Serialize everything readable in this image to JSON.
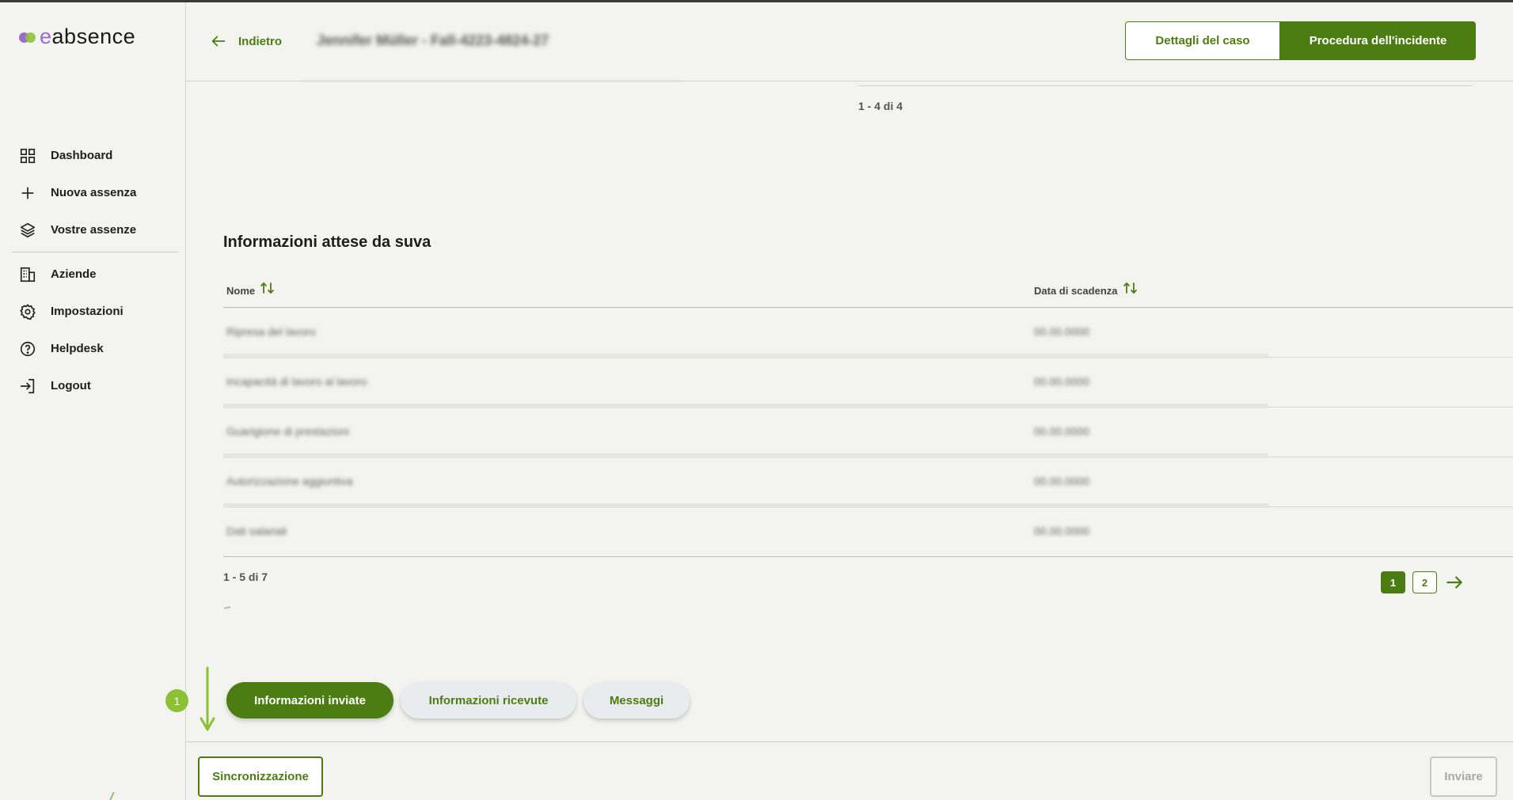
{
  "app": {
    "logo_prefix": "e",
    "logo_rest": "absence",
    "logo_icon": "logo-circles-icon"
  },
  "sidebar": {
    "items": [
      {
        "label": "Dashboard",
        "icon": "grid-icon"
      },
      {
        "label": "Nuova assenza",
        "icon": "plus-icon"
      },
      {
        "label": "Vostre assenze",
        "icon": "layers-icon"
      },
      {
        "label": "Aziende",
        "icon": "building-icon"
      },
      {
        "label": "Impostazioni",
        "icon": "gear-icon"
      },
      {
        "label": "Helpdesk",
        "icon": "help-circle-icon"
      },
      {
        "label": "Logout",
        "icon": "logout-icon"
      }
    ]
  },
  "header": {
    "back_label": "Indietro",
    "case_title": "Jennifer Müller - Fall-4223-4824-27",
    "btn_case_details": "Dettagli del caso",
    "btn_incident_procedure": "Procedura dell'incidente"
  },
  "upper": {
    "pagination": "1 - 4 di 4"
  },
  "section": {
    "title": "Informazioni attese da suva",
    "columns": {
      "name": "Nome",
      "due_date": "Data di scadenza"
    },
    "rows": [
      {
        "name": "Ripresa del lavoro",
        "date": "00.00.0000"
      },
      {
        "name": "Incapacità di lavoro al lavoro",
        "date": "00.00.0000"
      },
      {
        "name": "Guarigione di prestazioni",
        "date": "00.00.0000"
      },
      {
        "name": "Autorizzazione aggiuntiva",
        "date": "00.00.0000"
      },
      {
        "name": "Dati salariali",
        "date": "00.00.0000"
      }
    ],
    "pagination": "1 - 5 di 7",
    "pages": [
      "1",
      "2"
    ],
    "current_page": "1"
  },
  "tabs": [
    {
      "label": "Informazioni inviate",
      "active": true
    },
    {
      "label": "Informazioni ricevute",
      "active": false
    },
    {
      "label": "Messaggi",
      "active": false
    }
  ],
  "annotation": {
    "number": "1"
  },
  "footer": {
    "sync_label": "Sincronizzazione",
    "send_label": "Inviare"
  },
  "colors": {
    "accent": "#4c7d12",
    "annotation": "#8cc136",
    "background": "#f3f3ef"
  }
}
